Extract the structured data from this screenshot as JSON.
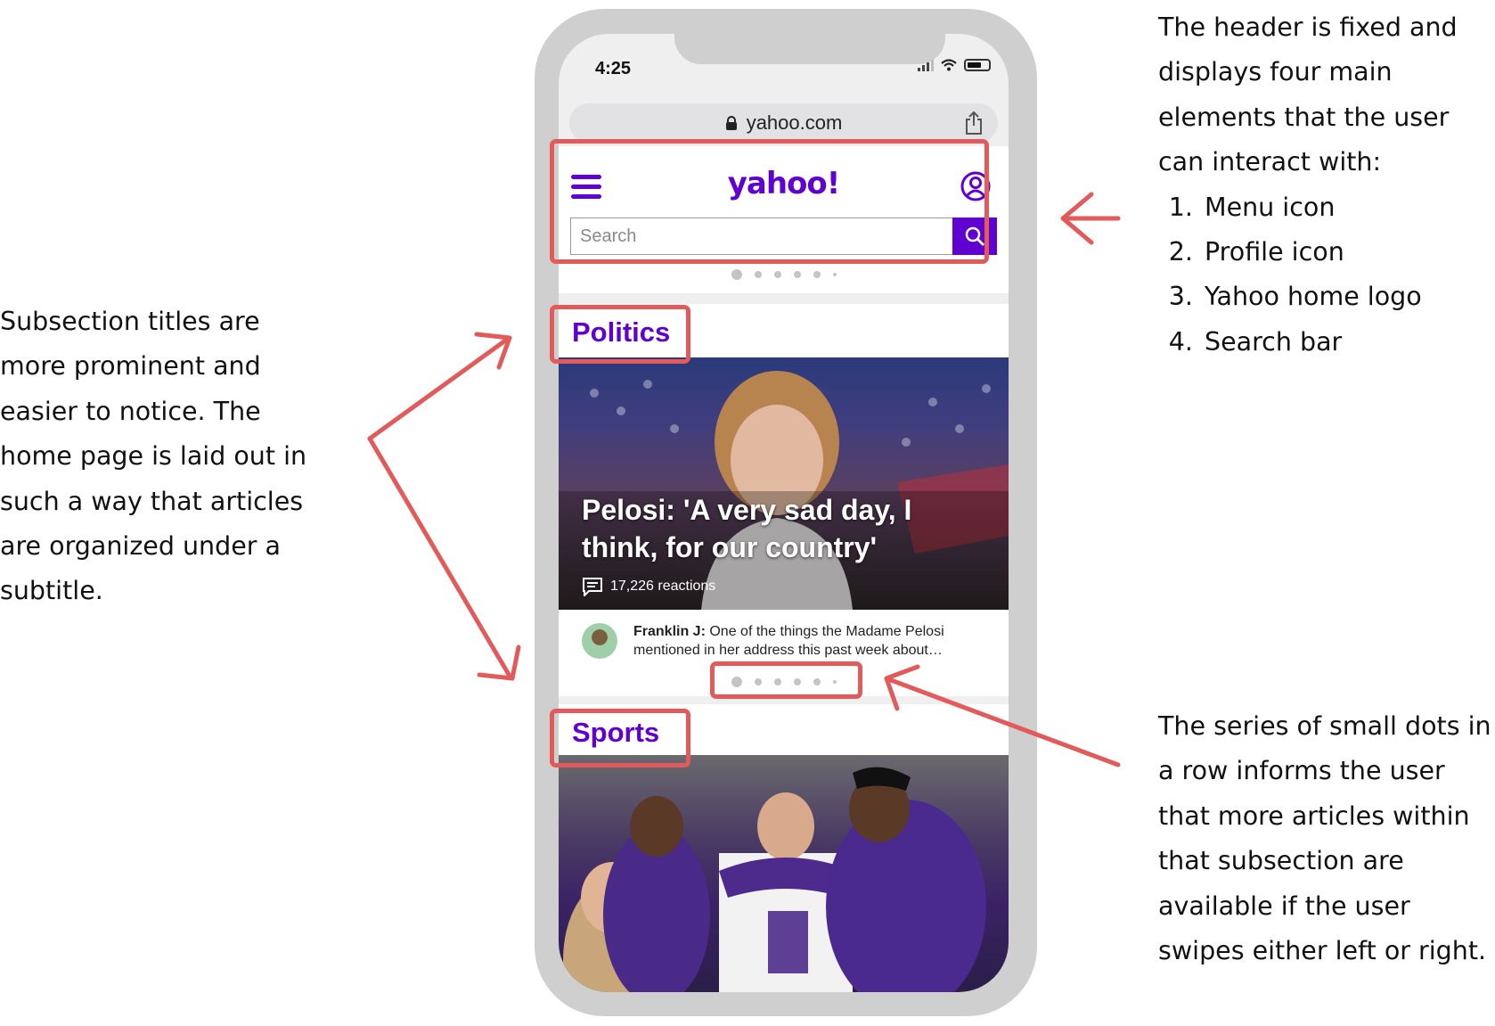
{
  "annotations": {
    "header_intro": "The header is fixed and displays four main elements that the user can interact with:",
    "header_items": [
      "Menu icon",
      "Profile icon",
      "Yahoo home logo",
      "Search bar"
    ],
    "subsections": "Subsection titles are more prominent and easier to notice. The home page is laid out in such a way that articles are organized under a subtitle.",
    "dots": "The series of small dots in a row informs the user that more articles within that subsection are available if the user swipes either left or right."
  },
  "status_bar": {
    "time": "4:25"
  },
  "browser": {
    "url": "yahoo.com"
  },
  "header": {
    "logo": "yahoo!",
    "search_placeholder": "Search"
  },
  "politics": {
    "title": "Politics",
    "headline": "Pelosi: 'A very sad day, I think, for our country'",
    "reactions": "17,226 reactions",
    "comment_author": "Franklin J:",
    "comment_text": "One of the things the Madame Pelosi mentioned in her address this past week about…"
  },
  "sports": {
    "title": "Sports"
  },
  "colors": {
    "accent": "#6001d2",
    "annotation": "#e25a5a"
  },
  "icons": [
    "menu-icon",
    "profile-icon",
    "search-icon",
    "lock-icon",
    "share-icon",
    "comment-icon"
  ]
}
